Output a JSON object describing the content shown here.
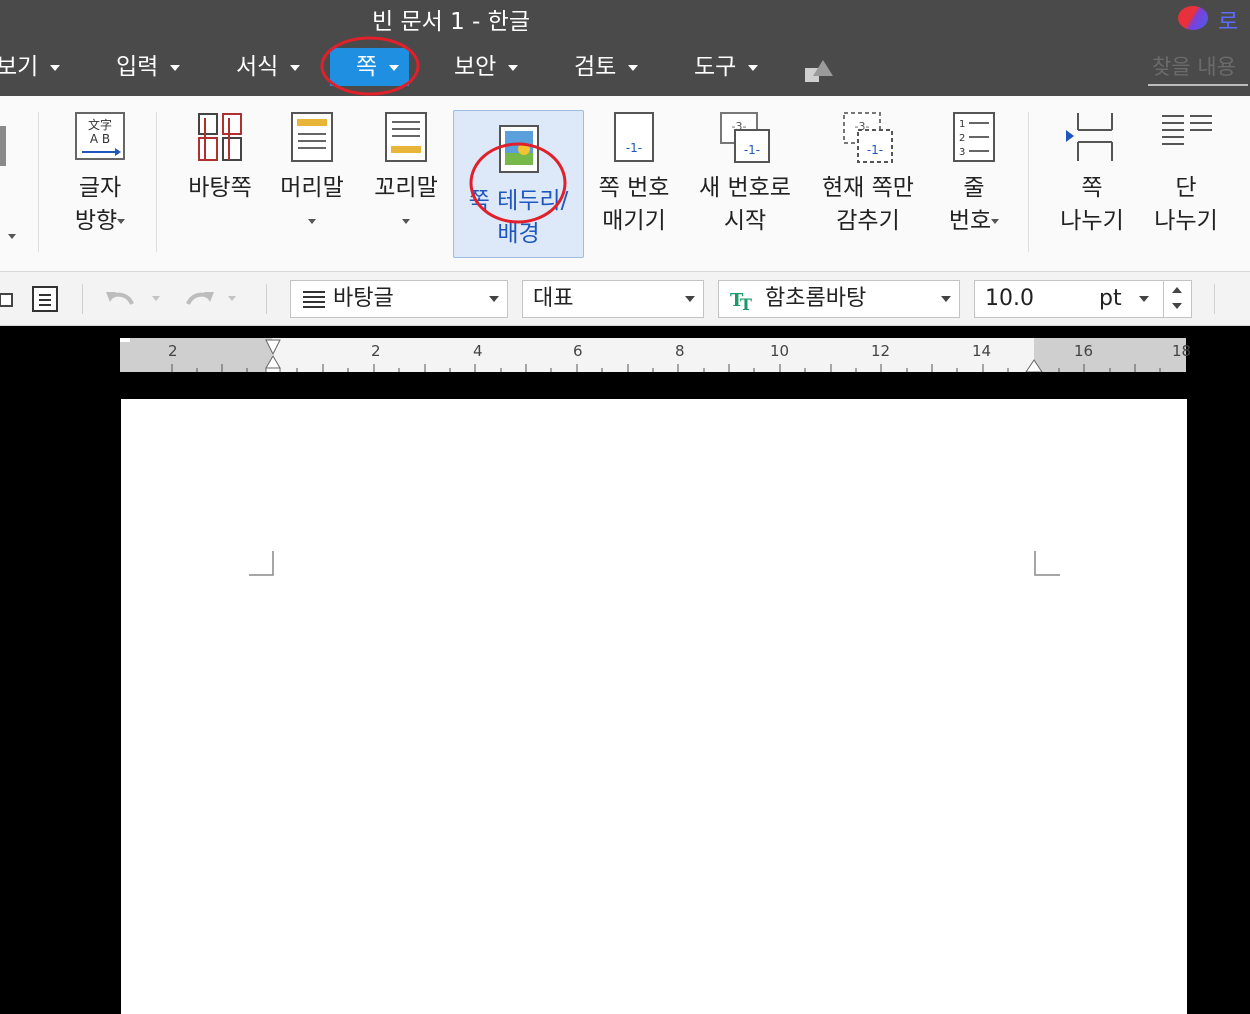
{
  "window": {
    "title": "빈 문서 1 - 한글",
    "login_label": "로그"
  },
  "menu": {
    "items": [
      {
        "label": "보기"
      },
      {
        "label": "입력"
      },
      {
        "label": "서식"
      },
      {
        "label": "쪽"
      },
      {
        "label": "보안"
      },
      {
        "label": "검토"
      },
      {
        "label": "도구"
      }
    ],
    "active": "쪽",
    "search_placeholder": "찾을 내용"
  },
  "ribbon": {
    "text_direction": {
      "line1": "글자",
      "line2": "방향"
    },
    "master_page": "바탕쪽",
    "header": "머리말",
    "footer": "꼬리말",
    "page_border": {
      "line1": "쪽 테두리/",
      "line2": "배경"
    },
    "page_number": {
      "line1": "쪽 번호",
      "line2": "매기기",
      "icon_text": "-1-"
    },
    "new_number": {
      "line1": "새 번호로",
      "line2": "시작",
      "icon_text_top": "-3-",
      "icon_text_bottom": "-1-"
    },
    "hide_page": {
      "line1": "현재 쪽만",
      "line2": "감추기",
      "icon_text_top": "-3-",
      "icon_text_bottom": "-1-"
    },
    "line_number": {
      "line1": "줄",
      "line2": "번호"
    },
    "page_break": {
      "line1": "쪽",
      "line2": "나누기"
    },
    "column_break": {
      "line1": "단",
      "line2": "나누기"
    },
    "text_direction_icon_chars": "文字 A B"
  },
  "toolbar": {
    "style": "바탕글",
    "font_category": "대표",
    "font": "함초롬바탕",
    "font_size": "10.0",
    "font_size_unit": "pt"
  },
  "ruler": {
    "labels": [
      "2",
      "2",
      "4",
      "6",
      "8",
      "10",
      "12",
      "14",
      "16",
      "18"
    ]
  },
  "annotations": {
    "circle_color": "#e0202a"
  },
  "colors": {
    "active_menu": "#1f8fe2",
    "titlebar": "#4a4a4a"
  }
}
